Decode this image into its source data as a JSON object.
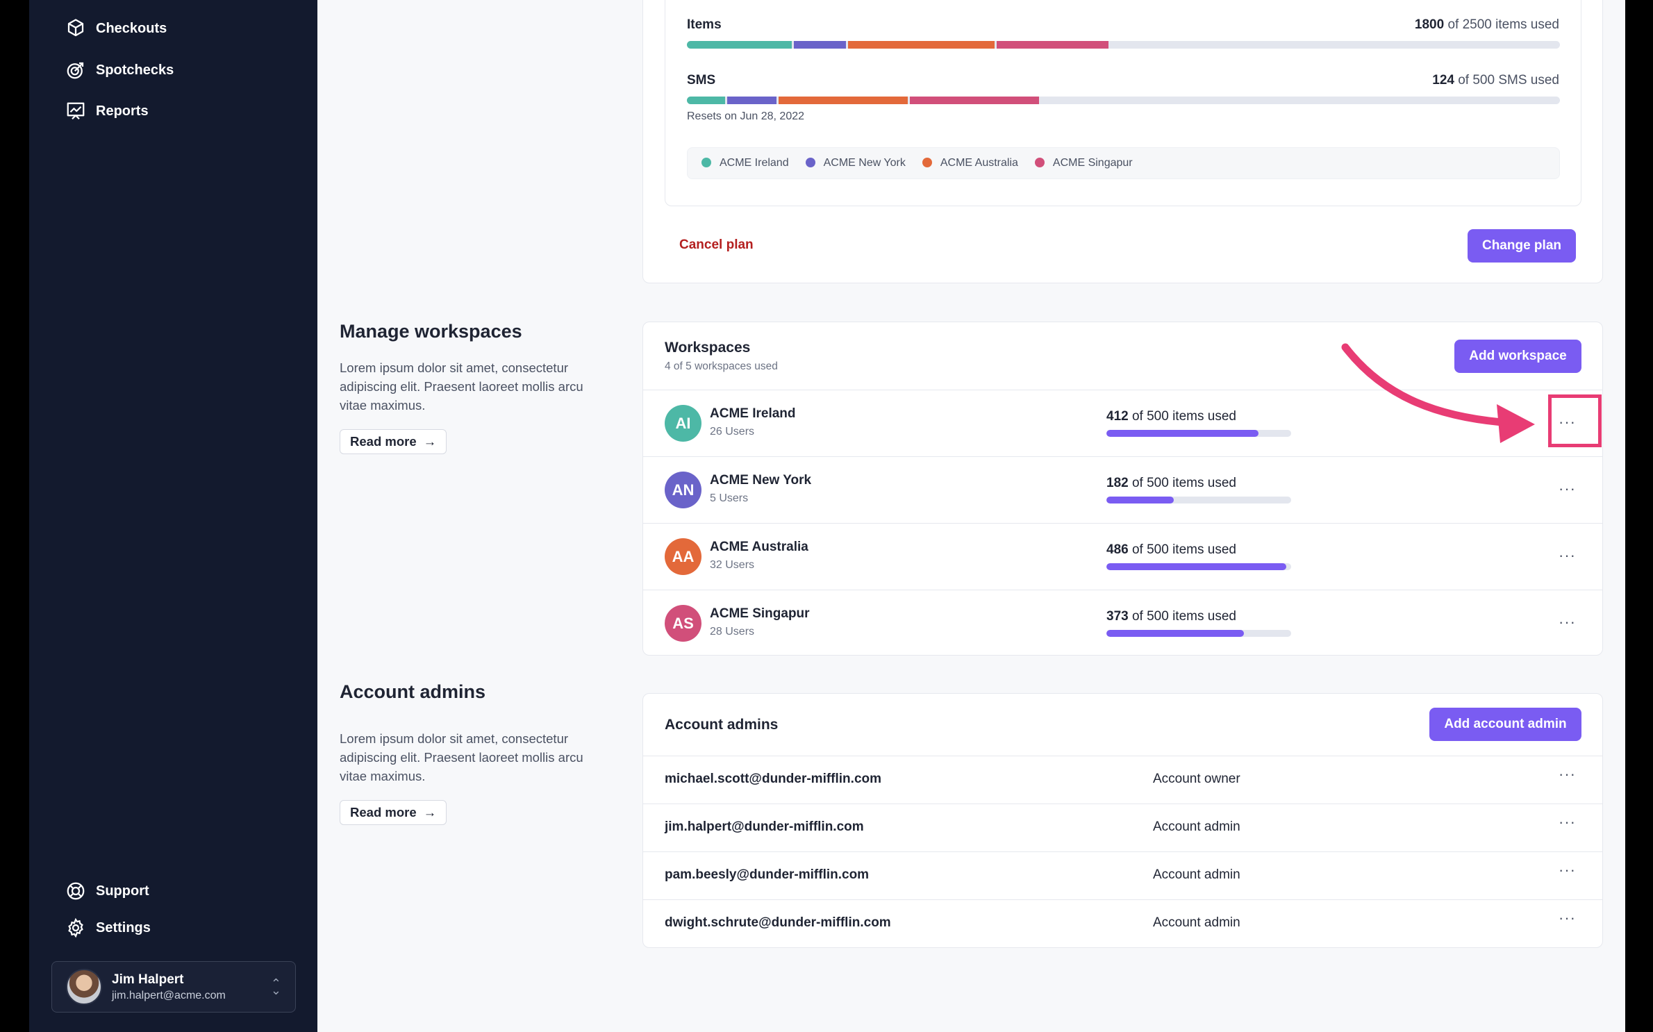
{
  "sidebar": {
    "nav": [
      {
        "label": "Checkouts",
        "icon": "box-icon"
      },
      {
        "label": "Spotchecks",
        "icon": "target-icon"
      },
      {
        "label": "Reports",
        "icon": "chart-icon"
      }
    ],
    "bottom": [
      {
        "label": "Support",
        "icon": "lifebuoy-icon"
      },
      {
        "label": "Settings",
        "icon": "gear-icon"
      }
    ],
    "user": {
      "name": "Jim Halpert",
      "email": "jim.halpert@acme.com"
    }
  },
  "plan": {
    "items": {
      "label": "Items",
      "used": "1800",
      "text": "of 2500 items used"
    },
    "sms": {
      "label": "SMS",
      "used": "124",
      "text": "of 500 SMS used",
      "resets": "Resets on Jun 28, 2022"
    },
    "legend": [
      {
        "label": "ACME Ireland",
        "color": "#4db8a6"
      },
      {
        "label": "ACME New York",
        "color": "#6a63c9"
      },
      {
        "label": "ACME Australia",
        "color": "#e3693a"
      },
      {
        "label": "ACME Singapur",
        "color": "#d14f7a"
      }
    ],
    "items_segments": [
      300,
      150,
      420,
      320
    ],
    "items_total": 2500,
    "sms_segments": [
      22,
      28,
      74,
      74
    ],
    "sms_total": 500,
    "cancel_label": "Cancel plan",
    "change_label": "Change plan"
  },
  "workspaces_section": {
    "title": "Manage workspaces",
    "desc": "Lorem ipsum dolor sit amet, consectetur adipiscing elit. Praesent laoreet mollis arcu vitae maximus.",
    "read_more": "Read more",
    "card_title": "Workspaces",
    "card_sub": "4 of 5 workspaces used",
    "add_label": "Add workspace",
    "rows": [
      {
        "initials": "AI",
        "name": "ACME Ireland",
        "users": "26 Users",
        "used": "412",
        "text": "of 500 items used",
        "fraction": 0.824,
        "color": "#4db8a6"
      },
      {
        "initials": "AN",
        "name": "ACME New York",
        "users": "5 Users",
        "used": "182",
        "text": "of 500 items used",
        "fraction": 0.364,
        "color": "#6a63c9"
      },
      {
        "initials": "AA",
        "name": "ACME Australia",
        "users": "32 Users",
        "used": "486",
        "text": "of 500 items used",
        "fraction": 0.972,
        "color": "#e3693a"
      },
      {
        "initials": "AS",
        "name": "ACME Singapur",
        "users": "28 Users",
        "used": "373",
        "text": "of 500 items used",
        "fraction": 0.746,
        "color": "#d14f7a"
      }
    ],
    "more": "···"
  },
  "admins_section": {
    "title": "Account admins",
    "desc": "Lorem ipsum dolor sit amet, consectetur adipiscing elit. Praesent laoreet mollis arcu vitae maximus.",
    "read_more": "Read more",
    "card_title": "Account admins",
    "add_label": "Add account admin",
    "rows": [
      {
        "email": "michael.scott@dunder-mifflin.com",
        "role": "Account owner"
      },
      {
        "email": "jim.halpert@dunder-mifflin.com",
        "role": "Account admin"
      },
      {
        "email": "pam.beesly@dunder-mifflin.com",
        "role": "Account admin"
      },
      {
        "email": "dwight.schrute@dunder-mifflin.com",
        "role": "Account admin"
      }
    ],
    "more": "···"
  },
  "annotation": {
    "color": "#e83c74"
  }
}
